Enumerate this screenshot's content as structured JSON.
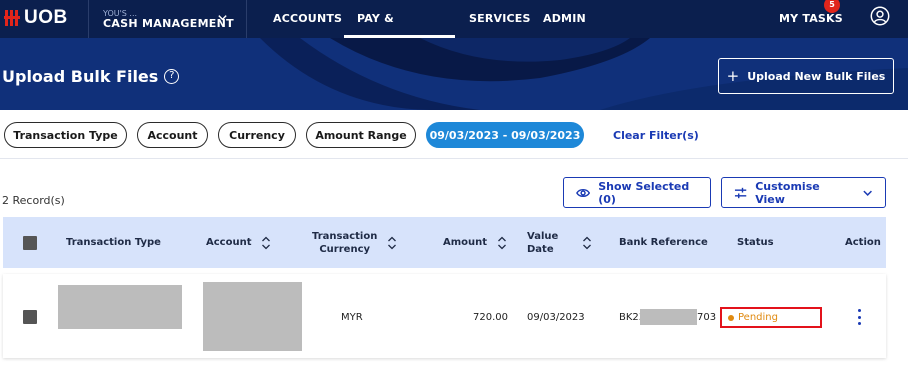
{
  "nav": {
    "logo_text": "UOB",
    "org_small": "YOU'S ...",
    "cash_management": "CASH MANAGEMENT",
    "links": [
      "ACCOUNTS",
      "PAY & TRANSFER",
      "SERVICES",
      "ADMIN"
    ],
    "active_link": "PAY & TRANSFER",
    "my_tasks": "MY TASKS",
    "tasks_badge": "5"
  },
  "page": {
    "title": "Upload Bulk Files",
    "upload_button": "Upload New Bulk Files"
  },
  "filters": {
    "chips": [
      "Transaction Type",
      "Account",
      "Currency",
      "Amount Range"
    ],
    "date_range": "09/03/2023 - 09/03/2023",
    "clear": "Clear Filter(s)"
  },
  "toolbar": {
    "records": "2 Record(s)",
    "show_selected": "Show Selected (0)",
    "customise_view": "Customise View"
  },
  "table": {
    "headers": {
      "transaction_type": "Transaction Type",
      "account": "Account",
      "currency_line1": "Transaction",
      "currency_line2": "Currency",
      "amount": "Amount",
      "value_date_line1": "Value",
      "value_date_line2": "Date",
      "bank_reference": "Bank Reference",
      "status": "Status",
      "action": "Action"
    },
    "rows": [
      {
        "currency": "MYR",
        "amount": "720.00",
        "value_date": "09/03/2023",
        "bank_ref_prefix": "BK23",
        "bank_ref_suffix": "703",
        "status": "Pending"
      }
    ]
  },
  "colors": {
    "nav_bg": "#0b1f4e",
    "banner_bg": "#0f2d72",
    "brand_red": "#e1251b",
    "link_blue": "#1a3ab4",
    "date_chip": "#1e88d8",
    "pending": "#e08a10",
    "highlight_box": "#e3121b",
    "header_row": "#d7e3fb"
  }
}
